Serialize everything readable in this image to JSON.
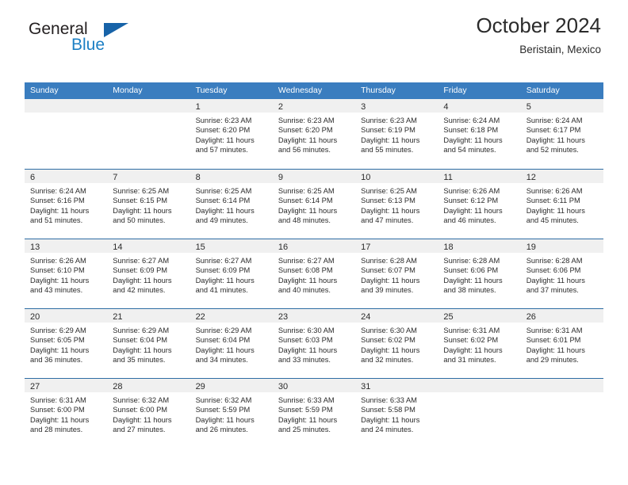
{
  "brand": {
    "name_part1": "General",
    "name_part2": "Blue",
    "triangle_icon": "brand-triangle-icon",
    "colors": {
      "dark": "#231f20",
      "blue": "#1c7fc4",
      "triangle": "#1763a8"
    }
  },
  "header": {
    "title": "October 2024",
    "subtitle": "Beristain, Mexico"
  },
  "theme": {
    "header_blue": "#3a7dbf",
    "row_divider_blue": "#2e6da4",
    "day_band_gray": "#f0f0f0",
    "text": "#2b2b2b"
  },
  "weekdays": [
    "Sunday",
    "Monday",
    "Tuesday",
    "Wednesday",
    "Thursday",
    "Friday",
    "Saturday"
  ],
  "weeks": [
    [
      {
        "day": "",
        "lines": []
      },
      {
        "day": "",
        "lines": []
      },
      {
        "day": "1",
        "lines": [
          "Sunrise: 6:23 AM",
          "Sunset: 6:20 PM",
          "Daylight: 11 hours",
          "and 57 minutes."
        ]
      },
      {
        "day": "2",
        "lines": [
          "Sunrise: 6:23 AM",
          "Sunset: 6:20 PM",
          "Daylight: 11 hours",
          "and 56 minutes."
        ]
      },
      {
        "day": "3",
        "lines": [
          "Sunrise: 6:23 AM",
          "Sunset: 6:19 PM",
          "Daylight: 11 hours",
          "and 55 minutes."
        ]
      },
      {
        "day": "4",
        "lines": [
          "Sunrise: 6:24 AM",
          "Sunset: 6:18 PM",
          "Daylight: 11 hours",
          "and 54 minutes."
        ]
      },
      {
        "day": "5",
        "lines": [
          "Sunrise: 6:24 AM",
          "Sunset: 6:17 PM",
          "Daylight: 11 hours",
          "and 52 minutes."
        ]
      }
    ],
    [
      {
        "day": "6",
        "lines": [
          "Sunrise: 6:24 AM",
          "Sunset: 6:16 PM",
          "Daylight: 11 hours",
          "and 51 minutes."
        ]
      },
      {
        "day": "7",
        "lines": [
          "Sunrise: 6:25 AM",
          "Sunset: 6:15 PM",
          "Daylight: 11 hours",
          "and 50 minutes."
        ]
      },
      {
        "day": "8",
        "lines": [
          "Sunrise: 6:25 AM",
          "Sunset: 6:14 PM",
          "Daylight: 11 hours",
          "and 49 minutes."
        ]
      },
      {
        "day": "9",
        "lines": [
          "Sunrise: 6:25 AM",
          "Sunset: 6:14 PM",
          "Daylight: 11 hours",
          "and 48 minutes."
        ]
      },
      {
        "day": "10",
        "lines": [
          "Sunrise: 6:25 AM",
          "Sunset: 6:13 PM",
          "Daylight: 11 hours",
          "and 47 minutes."
        ]
      },
      {
        "day": "11",
        "lines": [
          "Sunrise: 6:26 AM",
          "Sunset: 6:12 PM",
          "Daylight: 11 hours",
          "and 46 minutes."
        ]
      },
      {
        "day": "12",
        "lines": [
          "Sunrise: 6:26 AM",
          "Sunset: 6:11 PM",
          "Daylight: 11 hours",
          "and 45 minutes."
        ]
      }
    ],
    [
      {
        "day": "13",
        "lines": [
          "Sunrise: 6:26 AM",
          "Sunset: 6:10 PM",
          "Daylight: 11 hours",
          "and 43 minutes."
        ]
      },
      {
        "day": "14",
        "lines": [
          "Sunrise: 6:27 AM",
          "Sunset: 6:09 PM",
          "Daylight: 11 hours",
          "and 42 minutes."
        ]
      },
      {
        "day": "15",
        "lines": [
          "Sunrise: 6:27 AM",
          "Sunset: 6:09 PM",
          "Daylight: 11 hours",
          "and 41 minutes."
        ]
      },
      {
        "day": "16",
        "lines": [
          "Sunrise: 6:27 AM",
          "Sunset: 6:08 PM",
          "Daylight: 11 hours",
          "and 40 minutes."
        ]
      },
      {
        "day": "17",
        "lines": [
          "Sunrise: 6:28 AM",
          "Sunset: 6:07 PM",
          "Daylight: 11 hours",
          "and 39 minutes."
        ]
      },
      {
        "day": "18",
        "lines": [
          "Sunrise: 6:28 AM",
          "Sunset: 6:06 PM",
          "Daylight: 11 hours",
          "and 38 minutes."
        ]
      },
      {
        "day": "19",
        "lines": [
          "Sunrise: 6:28 AM",
          "Sunset: 6:06 PM",
          "Daylight: 11 hours",
          "and 37 minutes."
        ]
      }
    ],
    [
      {
        "day": "20",
        "lines": [
          "Sunrise: 6:29 AM",
          "Sunset: 6:05 PM",
          "Daylight: 11 hours",
          "and 36 minutes."
        ]
      },
      {
        "day": "21",
        "lines": [
          "Sunrise: 6:29 AM",
          "Sunset: 6:04 PM",
          "Daylight: 11 hours",
          "and 35 minutes."
        ]
      },
      {
        "day": "22",
        "lines": [
          "Sunrise: 6:29 AM",
          "Sunset: 6:04 PM",
          "Daylight: 11 hours",
          "and 34 minutes."
        ]
      },
      {
        "day": "23",
        "lines": [
          "Sunrise: 6:30 AM",
          "Sunset: 6:03 PM",
          "Daylight: 11 hours",
          "and 33 minutes."
        ]
      },
      {
        "day": "24",
        "lines": [
          "Sunrise: 6:30 AM",
          "Sunset: 6:02 PM",
          "Daylight: 11 hours",
          "and 32 minutes."
        ]
      },
      {
        "day": "25",
        "lines": [
          "Sunrise: 6:31 AM",
          "Sunset: 6:02 PM",
          "Daylight: 11 hours",
          "and 31 minutes."
        ]
      },
      {
        "day": "26",
        "lines": [
          "Sunrise: 6:31 AM",
          "Sunset: 6:01 PM",
          "Daylight: 11 hours",
          "and 29 minutes."
        ]
      }
    ],
    [
      {
        "day": "27",
        "lines": [
          "Sunrise: 6:31 AM",
          "Sunset: 6:00 PM",
          "Daylight: 11 hours",
          "and 28 minutes."
        ]
      },
      {
        "day": "28",
        "lines": [
          "Sunrise: 6:32 AM",
          "Sunset: 6:00 PM",
          "Daylight: 11 hours",
          "and 27 minutes."
        ]
      },
      {
        "day": "29",
        "lines": [
          "Sunrise: 6:32 AM",
          "Sunset: 5:59 PM",
          "Daylight: 11 hours",
          "and 26 minutes."
        ]
      },
      {
        "day": "30",
        "lines": [
          "Sunrise: 6:33 AM",
          "Sunset: 5:59 PM",
          "Daylight: 11 hours",
          "and 25 minutes."
        ]
      },
      {
        "day": "31",
        "lines": [
          "Sunrise: 6:33 AM",
          "Sunset: 5:58 PM",
          "Daylight: 11 hours",
          "and 24 minutes."
        ]
      },
      {
        "day": "",
        "lines": []
      },
      {
        "day": "",
        "lines": []
      }
    ]
  ]
}
